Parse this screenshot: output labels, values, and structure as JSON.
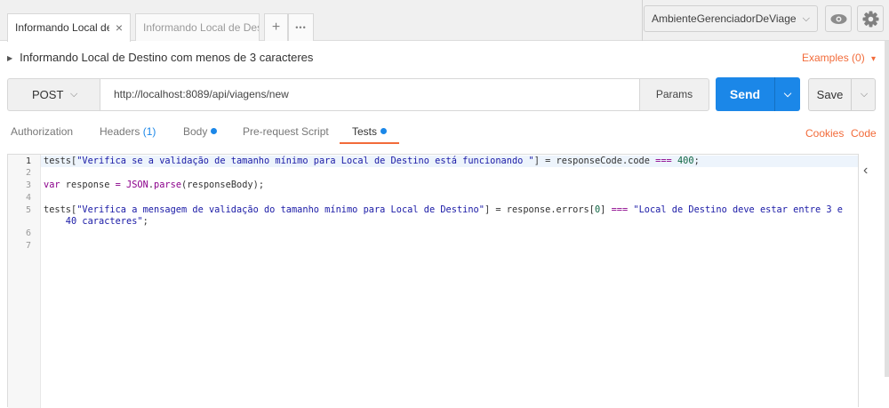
{
  "tabs": [
    {
      "title": "Informando Local de D",
      "active": true
    },
    {
      "title": "Informando Local de Destin",
      "active": false
    }
  ],
  "tab_close_glyph": "×",
  "tab_add_glyph": "+",
  "tab_more_glyph": "•••",
  "environment": {
    "selected": "AmbienteGerenciadorDeViage",
    "caret": "⌵"
  },
  "icons": {
    "eye": "eye-icon",
    "gear": "gear-icon"
  },
  "request": {
    "name": "Informando Local de Destino com menos de 3 caracteres",
    "examples_label": "Examples (0)",
    "examples_caret": "▾",
    "method": "POST",
    "method_caret": "⌵",
    "url": "http://localhost:8089/api/viagens/new",
    "params_label": "Params",
    "send_label": "Send",
    "send_caret": "⌵",
    "save_label": "Save",
    "save_caret": "⌵"
  },
  "subtabs": [
    {
      "label": "Authorization",
      "count": "",
      "dot": false,
      "active": false
    },
    {
      "label": "Headers",
      "count": "(1)",
      "dot": false,
      "active": false
    },
    {
      "label": "Body",
      "count": "",
      "dot": true,
      "active": false
    },
    {
      "label": "Pre-request Script",
      "count": "",
      "dot": false,
      "active": false
    },
    {
      "label": "Tests",
      "count": "",
      "dot": true,
      "active": true
    }
  ],
  "links": {
    "cookies": "Cookies",
    "code": "Code"
  },
  "editor": {
    "line_numbers": [
      "1",
      "2",
      "3",
      "4",
      "5",
      "6",
      "7"
    ],
    "collapse_glyph": "‹",
    "lines": {
      "l1": {
        "a": "tests[",
        "b": "\"Verifica se a validação de tamanho mínimo para Local de Destino está funcionando \"",
        "c": "] = responseCode.code ",
        "d": "===",
        "e": " ",
        "f": "400",
        "g": ";"
      },
      "l3": {
        "a": "var",
        "b": " response ",
        "c": "=",
        "d": " ",
        "e": "JSON",
        "f": ".",
        "g": "parse",
        "h": "(responseBody);"
      },
      "l5": {
        "a": "tests[",
        "b": "\"Verifica a mensagem de validação do tamanho mínimo para Local de Destino\"",
        "c": "] = response.errors[",
        "d": "0",
        "e": "] ",
        "f": "===",
        "g": " ",
        "h": "\"Local de Destino deve estar entre 3 e"
      },
      "l5b": {
        "a": "    40 caracteres\"",
        "b": ";"
      }
    }
  },
  "colors": {
    "accent": "#f26b3a",
    "send": "#1b87e8"
  }
}
